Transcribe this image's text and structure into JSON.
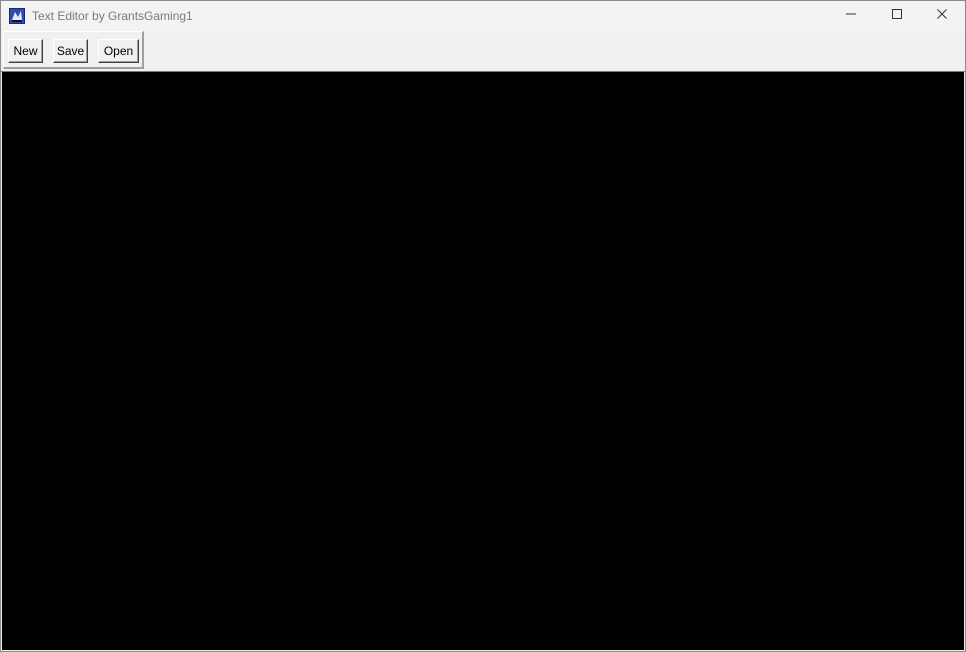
{
  "window": {
    "title": "Text Editor by GrantsGaming1",
    "app_icon": "feather-app-icon",
    "controls": {
      "minimize_icon": "minimize-icon",
      "maximize_icon": "maximize-icon",
      "close_icon": "close-icon"
    }
  },
  "toolbar": {
    "new_label": "New",
    "save_label": "Save",
    "open_label": "Open"
  },
  "editor": {
    "content": "",
    "background": "#000000"
  }
}
